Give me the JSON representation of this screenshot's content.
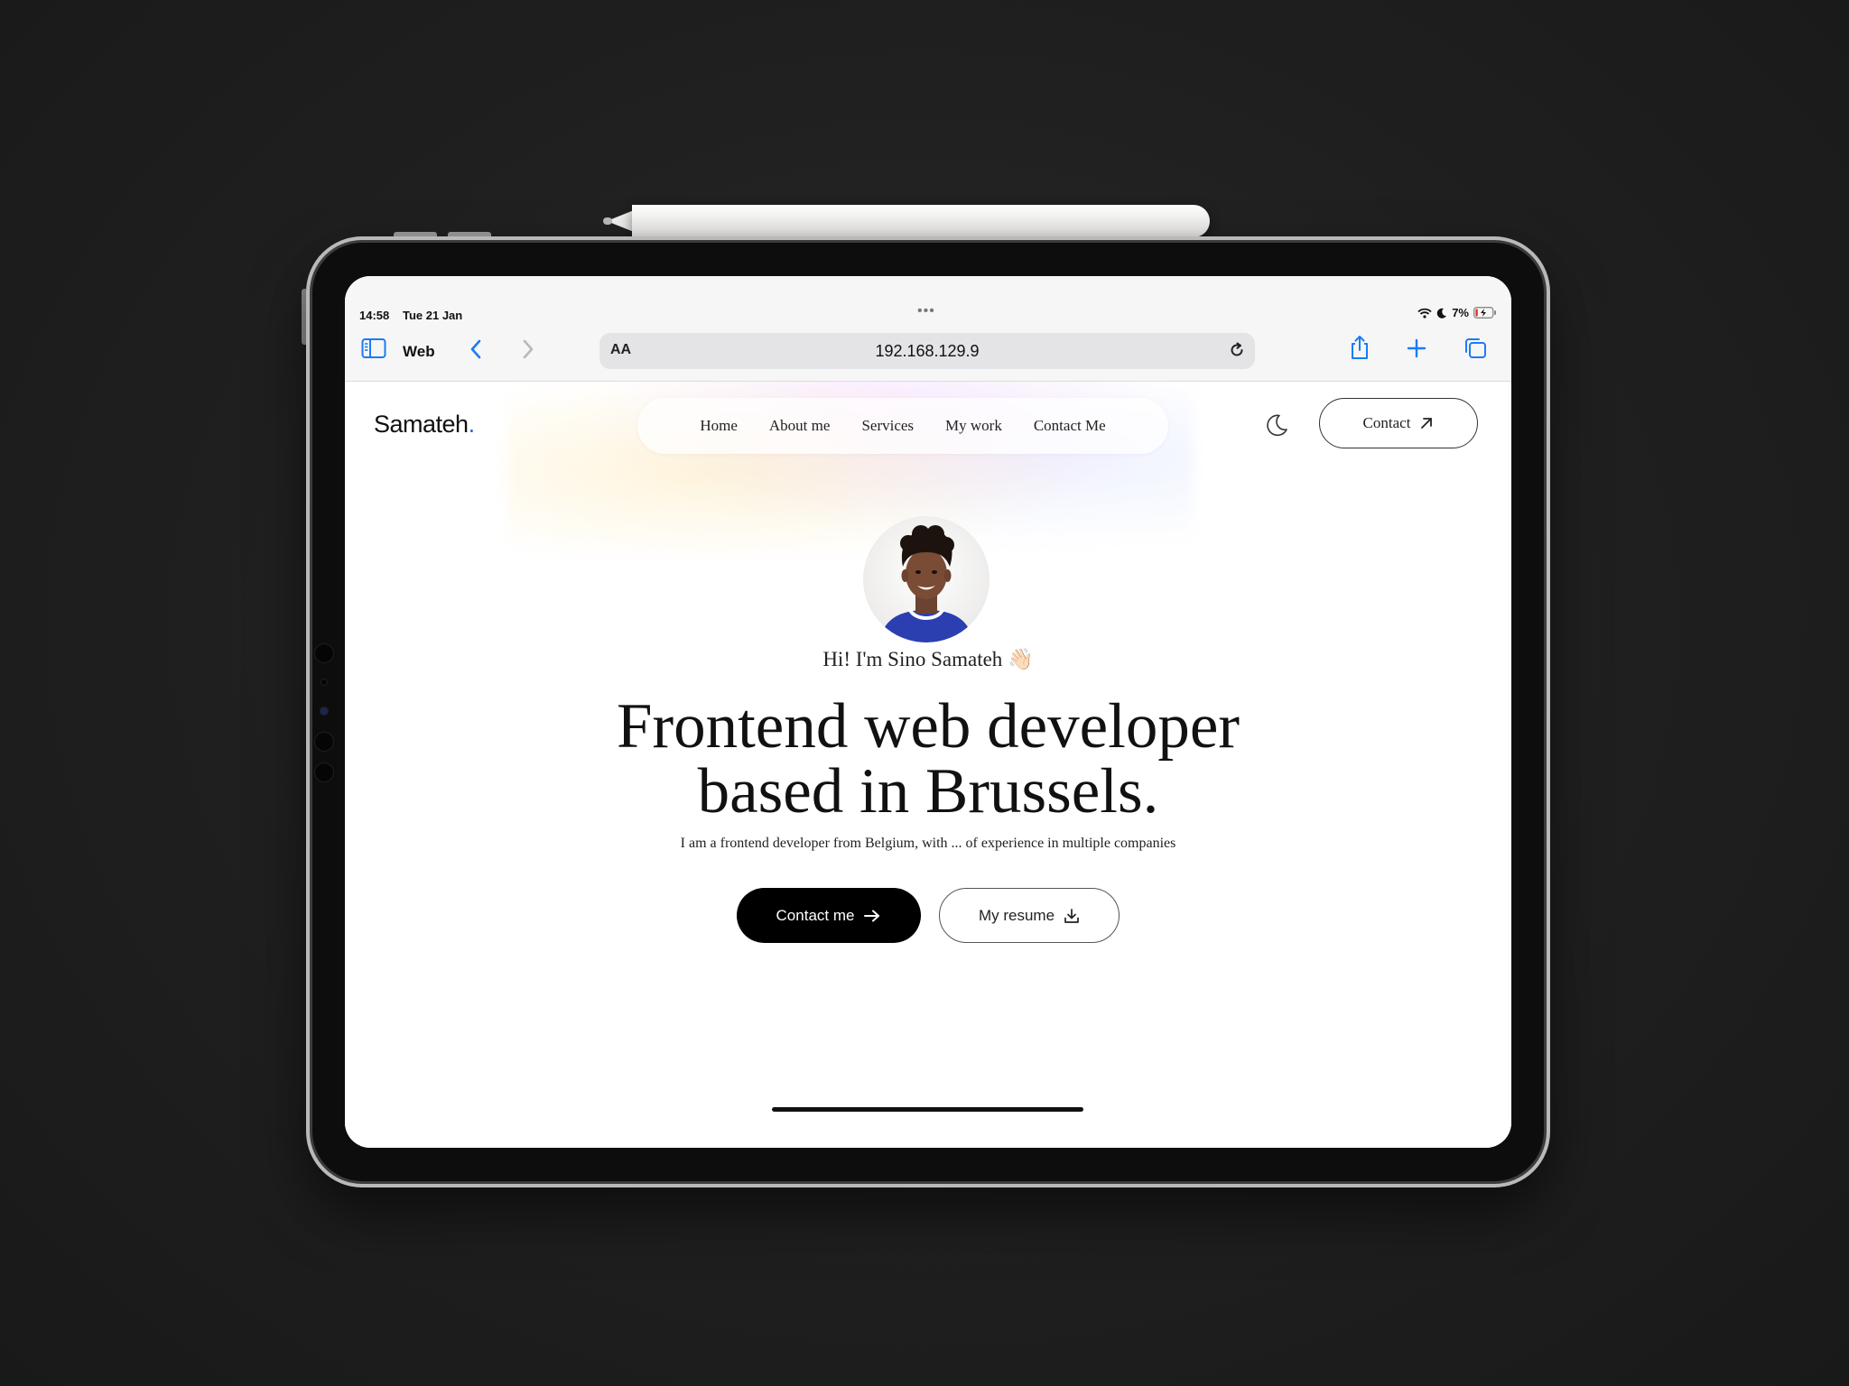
{
  "status_bar": {
    "time": "14:58",
    "date": "Tue 21 Jan",
    "battery": "7%"
  },
  "browser": {
    "tab_group_label": "Web",
    "url_text_size": "AA",
    "url": "192.168.129.9",
    "accent": "#1a7cf5"
  },
  "site": {
    "logo": "Samateh",
    "logo_dot": ".",
    "logo_dot_color": "#2f64d6",
    "nav": [
      "Home",
      "About me",
      "Services",
      "My work",
      "Contact Me"
    ],
    "contact_button": "Contact",
    "greeting": "Hi! I'm Sino Samateh",
    "greeting_emoji": "👋🏻",
    "headline_line1": "Frontend web developer",
    "headline_line2": "based in Brussels.",
    "subline": "I am a frontend developer from Belgium, with ... of experience in multiple companies",
    "primary_cta": "Contact me",
    "secondary_cta": "My resume"
  }
}
